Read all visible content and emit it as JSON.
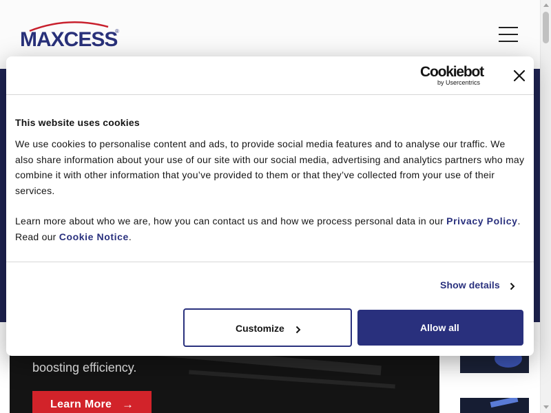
{
  "site": {
    "logo_text": "MAXCESS",
    "logo_mark": "®",
    "menu_icon": "hamburger-menu-icon",
    "hero_text": "boosting efficiency.",
    "learn_more_label": "Learn More",
    "learn_more_icon": "arrow-right-icon",
    "colors": {
      "navy": "#29307d",
      "hero": "#1f2454",
      "red": "#d2232a"
    }
  },
  "dialog": {
    "brand_word": "Cookiebot",
    "brand_sub": "by Usercentrics",
    "close_icon": "close-icon",
    "title": "This website uses cookies",
    "paragraph": "We use cookies to personalise content and ads, to provide social media features and to analyse our traffic. We also share information about your use of our site with our social media, advertising and analytics partners who may combine it with other information that you’ve provided to them or that they’ve collected from your use of their services.",
    "learn_prefix": "Learn more about who we are, how you can contact us and how we process personal data in our ",
    "privacy_link": "Privacy Policy",
    "learn_middle": ". Read our ",
    "cookie_link": "Cookie Notice",
    "learn_suffix": ".",
    "show_details": "Show details",
    "customize_label": "Customize",
    "allow_all_label": "Allow all"
  }
}
